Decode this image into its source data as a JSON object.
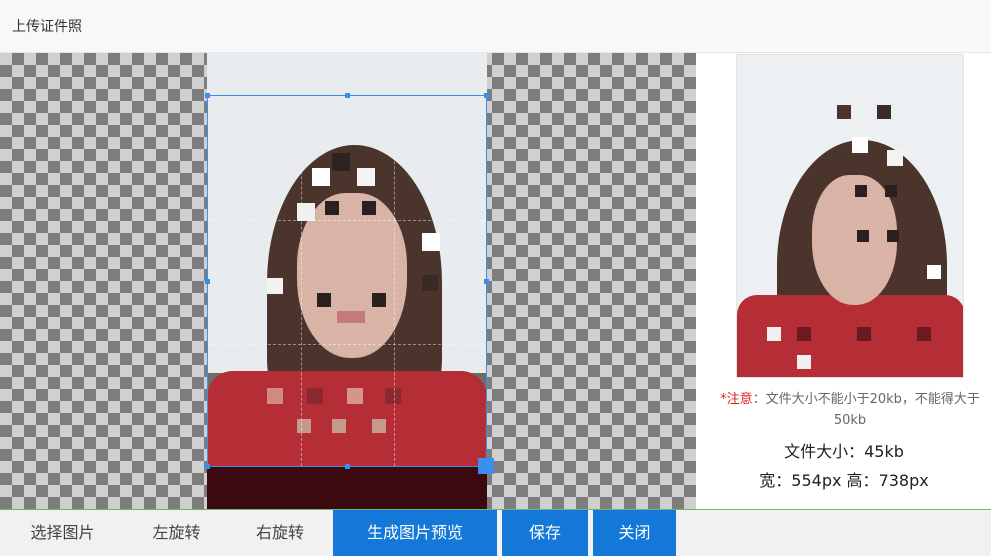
{
  "dialog": {
    "title": "上传证件照"
  },
  "preview": {
    "notice_label": "*注意",
    "notice_text": "：文件大小不能小于20kb，不能得大于50kb",
    "file_size_label": "文件大小：",
    "file_size_value": "45kb",
    "width_label": "宽：",
    "width_value": "554px",
    "height_label": "高：",
    "height_value": "738px"
  },
  "toolbar": {
    "select_image": "选择图片",
    "rotate_left": "左旋转",
    "rotate_right": "右旋转",
    "generate_preview": "生成图片预览",
    "save": "保存",
    "close": "关闭"
  },
  "colors": {
    "primary": "#1478d8",
    "crop_border": "#3b8df0",
    "notice_red": "#e02020"
  }
}
